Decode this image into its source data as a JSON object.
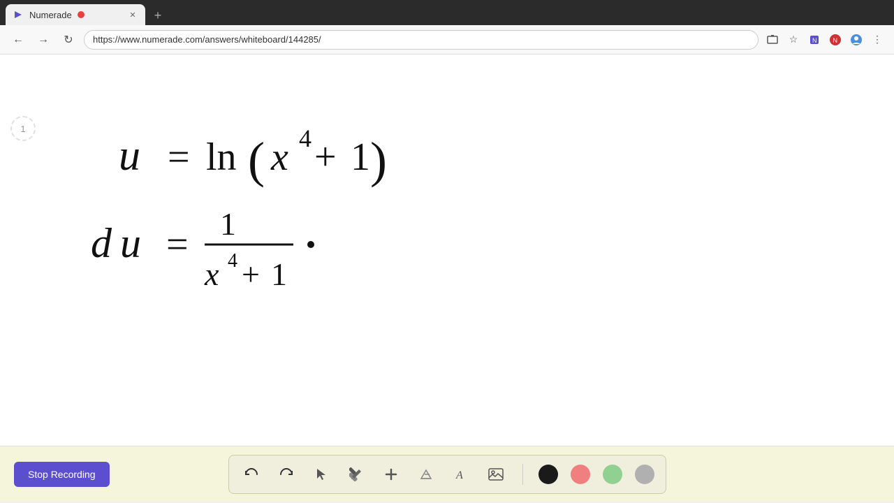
{
  "browser": {
    "tab_title": "Numerade",
    "url": "https://www.numerade.com/answers/whiteboard/144285/",
    "new_tab_label": "+"
  },
  "page_counter": "1",
  "toolbar": {
    "stop_recording_label": "Stop Recording",
    "tools": [
      {
        "name": "undo",
        "symbol": "↺"
      },
      {
        "name": "redo",
        "symbol": "↻"
      },
      {
        "name": "select",
        "symbol": "▲"
      },
      {
        "name": "pen",
        "symbol": "✏"
      },
      {
        "name": "plus",
        "symbol": "+"
      },
      {
        "name": "eraser",
        "symbol": "/"
      },
      {
        "name": "text",
        "symbol": "A"
      },
      {
        "name": "image",
        "symbol": "🖼"
      }
    ],
    "colors": [
      {
        "name": "black",
        "class": "color-black"
      },
      {
        "name": "pink",
        "class": "color-pink"
      },
      {
        "name": "green",
        "class": "color-green"
      },
      {
        "name": "gray",
        "class": "color-gray"
      }
    ]
  },
  "math": {
    "line1": "u = ln(x⁴ + 1)",
    "line2": "du = 1/(x⁴+1)"
  }
}
